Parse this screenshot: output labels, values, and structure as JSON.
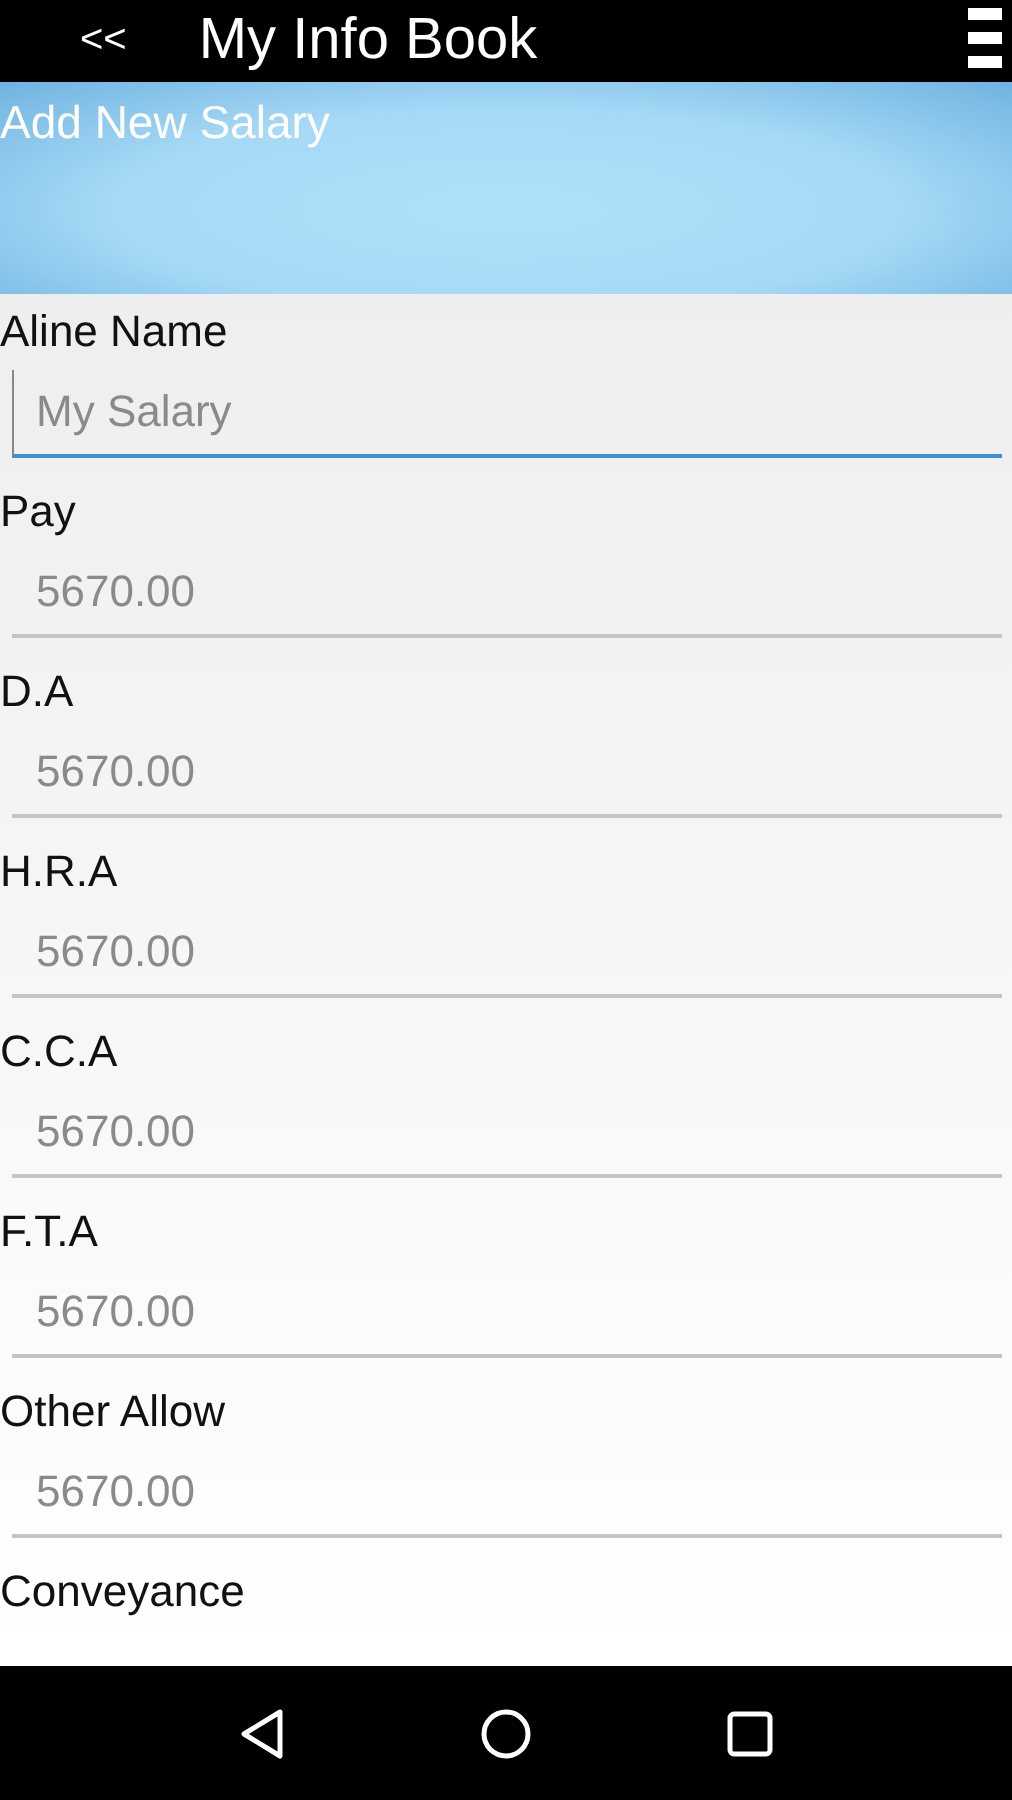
{
  "app_bar": {
    "back": "<<",
    "title": "My Info Book"
  },
  "banner": {
    "title": "Add New Salary"
  },
  "fields": [
    {
      "label": "Aline Name",
      "placeholder": "My Salary",
      "focused": true
    },
    {
      "label": "Pay",
      "placeholder": "5670.00",
      "focused": false
    },
    {
      "label": "D.A",
      "placeholder": "5670.00",
      "focused": false
    },
    {
      "label": "H.R.A",
      "placeholder": "5670.00",
      "focused": false
    },
    {
      "label": "C.C.A",
      "placeholder": "5670.00",
      "focused": false
    },
    {
      "label": "F.T.A",
      "placeholder": "5670.00",
      "focused": false
    },
    {
      "label": "Other Allow",
      "placeholder": "5670.00",
      "focused": false
    },
    {
      "label": "Conveyance"
    }
  ]
}
